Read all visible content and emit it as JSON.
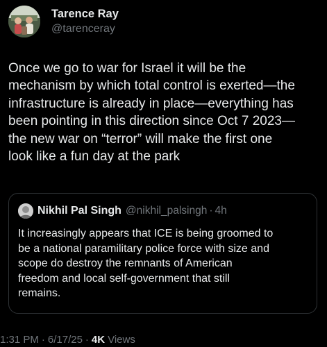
{
  "author": {
    "display_name": "Tarence Ray",
    "handle": "@tarenceray",
    "avatar_icon": "user-avatar-photo"
  },
  "tweet": {
    "text": "Once we go to war for Israel it will be the\nmechanism by which total control is exerted—the\ninfrastructure is already in place—everything has\nbeen pointing in this direction since Oct 7 2023—\nthe new war on “terror” will make the first one\nlook like a fun day at the park"
  },
  "quote": {
    "display_name": "Nikhil Pal Singh",
    "handle": "@nikhil_palsingh",
    "separator": "·",
    "time": "4h",
    "avatar_icon": "user-avatar-photo",
    "text": "It increasingly appears that ICE is being groomed to\nbe a national paramilitary police force with size and\nscope do destroy the remnants of American\nfreedom and local self-government that still\nremains."
  },
  "meta": {
    "time": "1:31 PM",
    "separator": "·",
    "date": "6/17/25",
    "views_count": "4K",
    "views_label": "Views"
  },
  "colors": {
    "background": "#000000",
    "primary_text": "#e7e9ea",
    "secondary_text": "#71767b",
    "card_border": "#2f3336"
  }
}
